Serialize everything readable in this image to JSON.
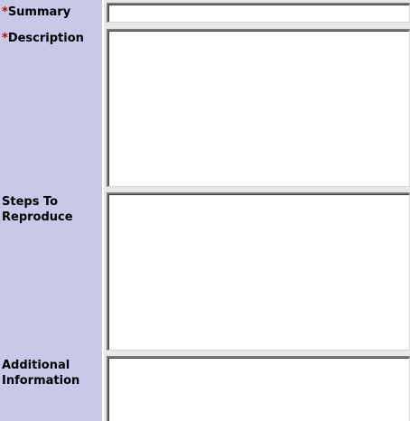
{
  "form": {
    "required_marker": "*",
    "fields": {
      "summary": {
        "label": "Summary",
        "required": true,
        "value": ""
      },
      "description": {
        "label": "Description",
        "required": true,
        "value": ""
      },
      "steps": {
        "label": "Steps To Reproduce",
        "required": false,
        "value": ""
      },
      "additional": {
        "label": "Additional Information",
        "required": false,
        "value": ""
      }
    }
  },
  "colors": {
    "label_bg": "#c8c8e8",
    "field_bg": "#e8e8e8",
    "required": "#cc0000"
  }
}
